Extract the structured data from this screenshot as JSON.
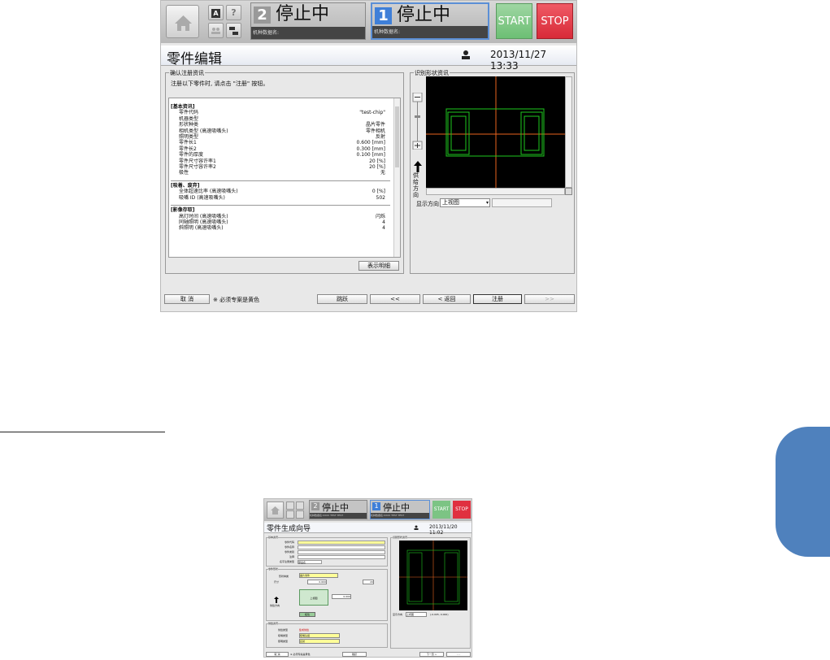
{
  "main": {
    "machine2": {
      "num": "2",
      "status": "停止中",
      "name_label": "机种数据名:"
    },
    "machine1": {
      "num": "1",
      "status": "停止中",
      "name_label": "机种数据名:"
    },
    "start_label": "START",
    "stop_label": "STOP",
    "mode_a": "A",
    "help_q": "?",
    "page_title": "零件编辑",
    "datetime": "2013/11/27 13:33",
    "confirm_group": "确认注册资讯",
    "confirm_msg": "注册以下零件时, 请点击 \"注册\" 按钮。",
    "sections": [
      {
        "title": "[基本资讯]",
        "rows": [
          {
            "label": "零件代码",
            "value": "\"test-chip\""
          },
          {
            "label": "机器类型",
            "value": ""
          },
          {
            "label": "形状种类",
            "value": "晶片零件"
          },
          {
            "label": "相机类型 (高速吸嘴头)",
            "value": "零件相机"
          },
          {
            "label": "照明类型",
            "value": "反射"
          },
          {
            "label": "零件长1",
            "value": "0.600 [mm]"
          },
          {
            "label": "零件长2",
            "value": "0.300 [mm]"
          },
          {
            "label": "零件的厚度",
            "value": "0.100 [mm]"
          },
          {
            "label": "零件尺寸容许率1",
            "value": "20 [%]"
          },
          {
            "label": "零件尺寸容许率2",
            "value": "20 [%]"
          },
          {
            "label": "极性",
            "value": "无"
          }
        ]
      },
      {
        "title": "[吸着、废弃]",
        "rows": [
          {
            "label": "全体超速比率 (高速吸嘴头)",
            "value": "0 [%]"
          },
          {
            "label": "吸嘴 ID (高速吸嘴头)",
            "value": "502"
          }
        ]
      },
      {
        "title": "[影像存取]",
        "rows": [
          {
            "label": "高灯时间 (高速吸嘴头)",
            "value": "闪烁"
          },
          {
            "label": "同轴照明 (高速吸嘴头)",
            "value": "4"
          },
          {
            "label": "斜照明 (高速吸嘴头)",
            "value": "4"
          }
        ]
      }
    ],
    "detail_button": "表示明细",
    "shape_group": "识别形状资讯",
    "supply_dir": "供给方向",
    "display_dir_label": "显示方向",
    "display_dir_value": "上视图",
    "bottom": {
      "cancel": "取  消",
      "note": "※ 必须专案是黄色",
      "jump": "跳跃",
      "prev_prev": "<<",
      "back": "< 返回",
      "register": "注册",
      "next_next": ">>"
    }
  },
  "thumb": {
    "machine2": {
      "num": "2",
      "status": "停止中",
      "name_label": "机种数据名:XXXX TEST TEST"
    },
    "machine1": {
      "num": "1",
      "status": "停止中",
      "name_label": "机种数据名:XXXX TEST TEST"
    },
    "start_label": "START",
    "stop_label": "STOP",
    "page_title": "零件生成向导",
    "datetime": "2013/11/20 11:02",
    "basic_group": "基本资讯",
    "fields": [
      "零件代码",
      "零件名称",
      "零件类别",
      "注释",
      "名字注册类型"
    ],
    "name_type_value": "部品名",
    "shape_group": "零件形状",
    "shape_kind_label": "形状种类",
    "shape_kind_value": "晶片零件",
    "dim_label": "尺寸",
    "dim_value": "0.600",
    "tol_value": "20",
    "view_label": "上视图",
    "supply_dir": "供给方向",
    "thick_value": "0.000",
    "polarity_label": "极性",
    "supply_group": "供给资讯",
    "feeder_label": "供给类型",
    "feeder_value": "集成供给",
    "nozzle_label": "吸嘴类型",
    "nozzle_value": "吸嘴头组",
    "light_label": "照明类型",
    "light_value": "反射",
    "recog_group": "识别形状资讯",
    "display_dir_label": "显示方向",
    "display_dir_value": "上视图",
    "coords": "(-0.005, 0.000)",
    "bottom": {
      "cancel": "取 消",
      "note": "※ 必须专案是黄色",
      "jump": "跳跃",
      "next": "下一页 >",
      "next_next": ">>"
    }
  },
  "side_tab_color": "#4f81bd"
}
